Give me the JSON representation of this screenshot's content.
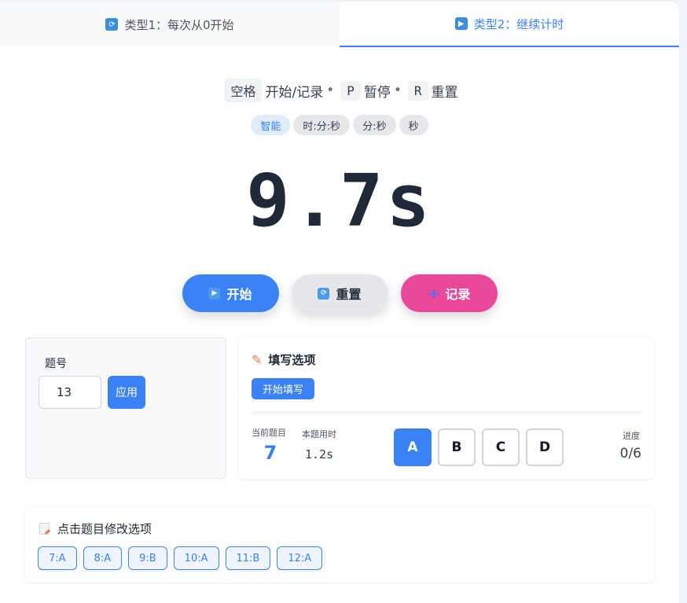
{
  "tabs": [
    {
      "label": "类型1：每次从0开始",
      "icon": "refresh-icon",
      "active": false
    },
    {
      "label": "类型2：继续计时",
      "icon": "play-icon",
      "active": true
    }
  ],
  "shortcuts": {
    "start_key": "空格",
    "start_text": "开始/记录",
    "sep": "•",
    "pause_key": "P",
    "pause_text": "暂停",
    "reset_key": "R",
    "reset_text": "重置"
  },
  "formats": [
    "智能",
    "时:分:秒",
    "分:秒",
    "秒"
  ],
  "timer": {
    "display": "9.7s"
  },
  "actions": {
    "start": "开始",
    "reset": "重置",
    "record": "记录"
  },
  "question": {
    "label": "题号",
    "value": "13",
    "apply": "应用"
  },
  "fill": {
    "title": "填写选项",
    "start_button": "开始填写",
    "current_label": "当前题目",
    "current_value": "7",
    "time_label": "本题用时",
    "time_value": "1.2s",
    "options": [
      "A",
      "B",
      "C",
      "D"
    ],
    "selected": "A",
    "progress_label": "进度",
    "progress_value": "0/6"
  },
  "history": {
    "title": "点击题目修改选项",
    "items": [
      "7:A",
      "8:A",
      "9:B",
      "10:A",
      "11:B",
      "12:A"
    ]
  },
  "colors": {
    "accent": "#3b82f6",
    "record": "#ec4899",
    "text": "#1f2937"
  }
}
